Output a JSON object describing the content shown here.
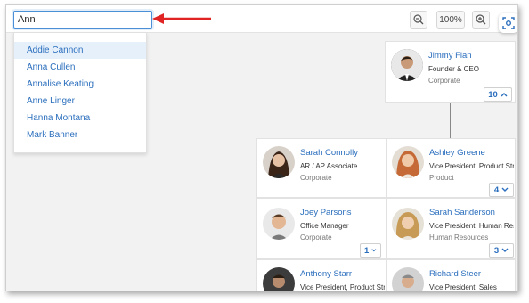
{
  "search": {
    "value": "Ann"
  },
  "suggestions": [
    "Addie Cannon",
    "Anna Cullen",
    "Annalise Keating",
    "Anne Linger",
    "Hanna Montana",
    "Mark Banner"
  ],
  "zoom": {
    "level": "100%"
  },
  "cards": [
    {
      "name": "Jimmy Flan",
      "title": "Founder & CEO",
      "dept": "Corporate",
      "count": "10",
      "chevron": "up"
    },
    {
      "name": "Sarah Connolly",
      "title": "AR / AP Associate",
      "dept": "Corporate"
    },
    {
      "name": "Ashley Greene",
      "title": "Vice President, Product Str...",
      "dept": "Product",
      "count": "4",
      "chevron": "down"
    },
    {
      "name": "Joey Parsons",
      "title": "Office Manager",
      "dept": "Corporate",
      "count": "1",
      "chevron": "down"
    },
    {
      "name": "Sarah Sanderson",
      "title": "Vice President, Human Res...",
      "dept": "Human Resources",
      "count": "3",
      "chevron": "down"
    },
    {
      "name": "Anthony Starr",
      "title": "Vice President, Product Str..."
    },
    {
      "name": "Richard Steer",
      "title": "Vice President, Sales"
    }
  ],
  "colors": {
    "accent": "#2a6ebd",
    "arrow": "#e02424",
    "highlight": "#e6f0fb"
  }
}
